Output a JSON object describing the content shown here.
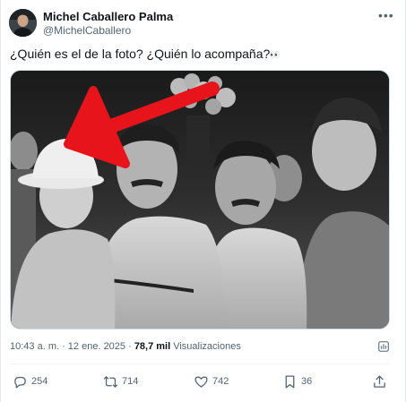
{
  "post": {
    "author_name": "Michel Caballero Palma",
    "author_handle": "@MichelCaballero",
    "text": "¿Quién es el de la foto? ¿Quién lo acompaña?",
    "text_emoji": "👀",
    "timestamp": "10:43 a. m. · 12 ene. 2025 · ",
    "views_count": "78,7 mil",
    "views_label": " Visualizaciones"
  },
  "actions": {
    "replies": "254",
    "reposts": "714",
    "likes": "742",
    "bookmarks": "36"
  },
  "icons": {
    "more": "more-horizontal-icon",
    "stats": "analytics-icon",
    "reply": "reply-icon",
    "repost": "repost-icon",
    "like": "heart-icon",
    "bookmark": "bookmark-icon",
    "share": "share-icon"
  },
  "colors": {
    "text_primary": "#0f1419",
    "text_secondary": "#536471",
    "arrow_red": "#e8141c"
  }
}
